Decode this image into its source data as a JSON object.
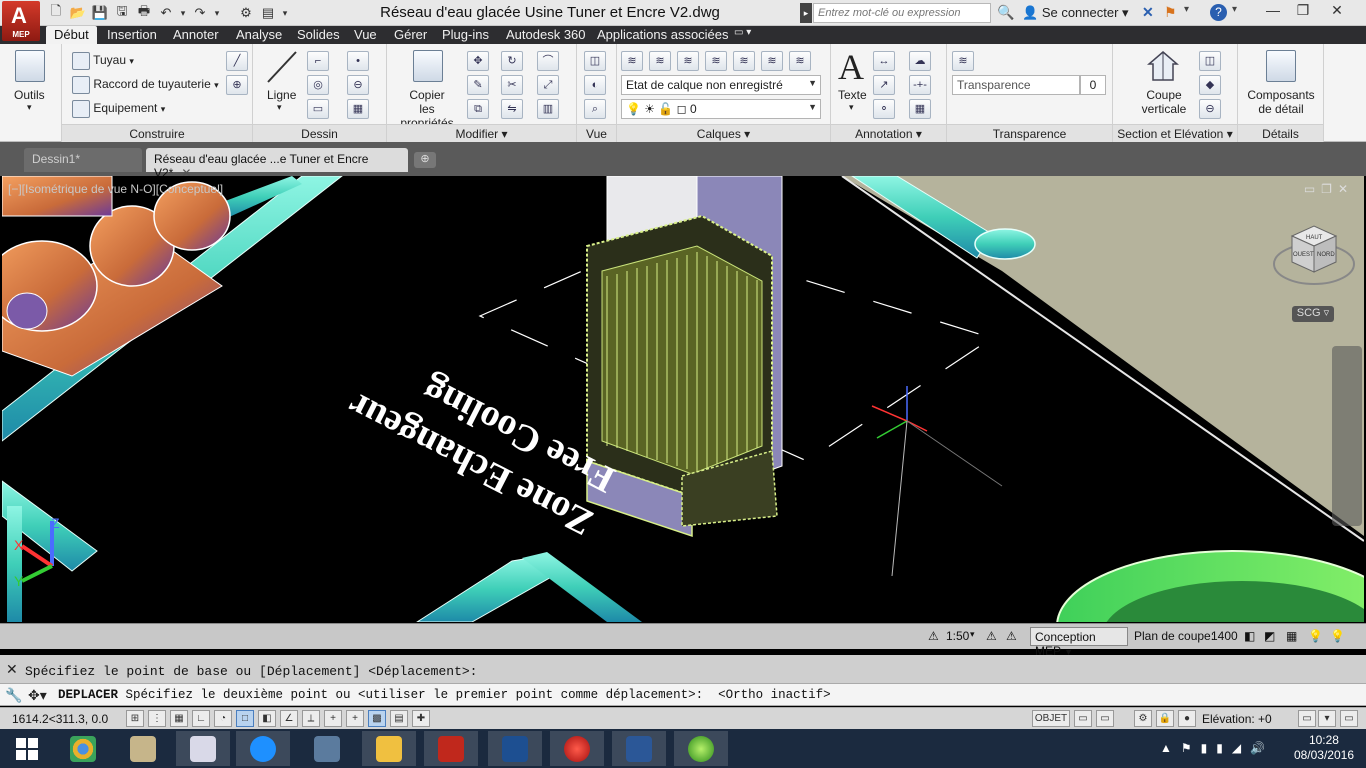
{
  "app": {
    "button_label": "MEP",
    "logo_letter": "A"
  },
  "title_bar": {
    "document_title": "Réseau d'eau glacée Usine Tuner et Encre V2.dwg",
    "search_placeholder": "Entrez mot-clé ou expression",
    "sign_in": "Se connecter",
    "help": "?"
  },
  "ribbon_tabs": [
    "Début",
    "Insertion",
    "Annoter",
    "Analyse",
    "Solides",
    "Vue",
    "Gérer",
    "Plug-ins",
    "Autodesk 360",
    "Applications associées"
  ],
  "ribbon": {
    "outils": {
      "label": "Outils"
    },
    "construire": {
      "title": "Construire",
      "items": [
        "Tuyau",
        "Raccord de tuyauterie",
        "Equipement"
      ]
    },
    "dessin": {
      "title": "Dessin",
      "ligne": "Ligne"
    },
    "modifier": {
      "title": "Modifier",
      "copier": "Copier\nles propriétés"
    },
    "vue": {
      "title": "Vue"
    },
    "calques": {
      "title": "Calques",
      "layer_state": "Etat de calque non enregistré",
      "current_layer": "0"
    },
    "annotation": {
      "title": "Annotation",
      "texte": "Texte"
    },
    "transparence": {
      "title": "Transparence",
      "label": "Transparence",
      "value": "0"
    },
    "section": {
      "title": "Section et Elévation",
      "coupe": "Coupe verticale"
    },
    "details": {
      "title": "Détails",
      "composants": "Composants de détail"
    }
  },
  "file_tabs": [
    {
      "label": "Dessin1*",
      "active": false
    },
    {
      "label": "Réseau d'eau glacée ...e Tuner et Encre V2*",
      "active": true
    }
  ],
  "viewport": {
    "label": "[−][Isométrique de vue N-O][Conceptuel]",
    "scg": "SCG",
    "text_line1": "Zone Echangeur",
    "text_line2": "Free Cooling",
    "axis_z": "Z",
    "axis_x": "X",
    "axis_y": "Y",
    "viewcube_top": "HAUT",
    "viewcube_left": "OUEST",
    "viewcube_right": "NORD"
  },
  "viewport_status": {
    "scale": "1:50",
    "configuration": "Conception MEP",
    "cut_plane_label": "Plan de coupe:",
    "cut_plane_value": "1400"
  },
  "command": {
    "history": "Spécifiez le point de base ou [Déplacement] <Déplacement>:",
    "prompt_cmd": "DEPLACER",
    "prompt_text": " Spécifiez le deuxième point ou <utiliser le premier point comme déplacement>:  <Ortho inactif>"
  },
  "status_bar": {
    "coords": "1614.2<311.3, 0.0",
    "objet": "OBJET",
    "elevation": "Elévation: +0"
  },
  "taskbar": {
    "time": "10:28",
    "date": "08/03/2016"
  },
  "colors": {
    "pipe": "#4fd6c3",
    "machine": "#e38a4a",
    "exchanger": "#c9e27a",
    "floor": "#b8b6a0",
    "ribbon_bg": "#f4f4f4",
    "tab_bar": "#2d2d30"
  }
}
